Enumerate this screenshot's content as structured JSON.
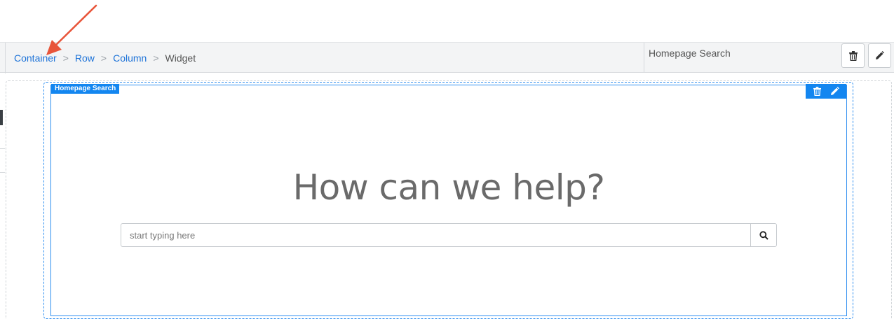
{
  "breadcrumb": {
    "items": [
      {
        "label": "Container",
        "link": true
      },
      {
        "label": "Row",
        "link": true
      },
      {
        "label": "Column",
        "link": true
      },
      {
        "label": "Widget",
        "link": false
      }
    ],
    "separator": ">"
  },
  "toolbar": {
    "widget_name": "Homepage Search",
    "delete_icon": "trash-icon",
    "edit_icon": "pencil-icon"
  },
  "widget": {
    "label": "Homepage Search",
    "headline": "How can we help?",
    "search": {
      "placeholder": "start typing here",
      "value": "",
      "button_icon": "search-icon"
    }
  },
  "annotation": {
    "type": "arrow",
    "color": "#e8553a",
    "points_to": "Container"
  },
  "colors": {
    "accent": "#1386f0",
    "link": "#1e73d8",
    "toolbar_bg": "#f3f4f5",
    "headline": "#6a6a6a"
  }
}
